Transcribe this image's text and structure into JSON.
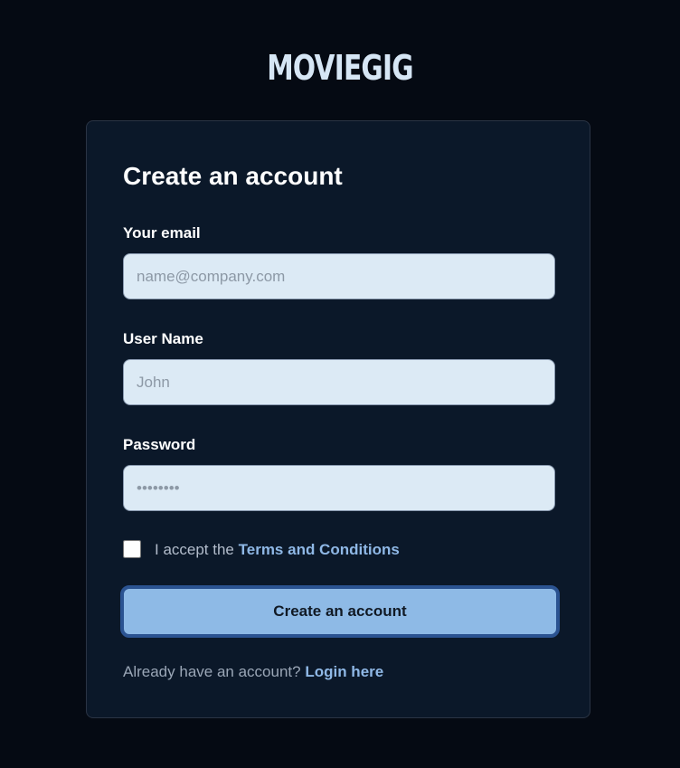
{
  "brand": {
    "name": "MOVIEGIG"
  },
  "form": {
    "title": "Create an account",
    "email": {
      "label": "Your email",
      "placeholder": "name@company.com",
      "value": ""
    },
    "username": {
      "label": "User Name",
      "placeholder": "John",
      "value": ""
    },
    "password": {
      "label": "Password",
      "placeholder": "••••••••",
      "value": ""
    },
    "terms": {
      "prefix": "I accept the",
      "link_label": "Terms and Conditions",
      "checked": false
    },
    "submit_label": "Create an account",
    "footer": {
      "prefix": "Already have an account?",
      "link_label": "Login here"
    }
  },
  "colors": {
    "background": "#050a13",
    "card": "#0b1829",
    "accent": "#8ebae6",
    "link": "#8fb8e6",
    "input_bg": "#dceaf5"
  }
}
